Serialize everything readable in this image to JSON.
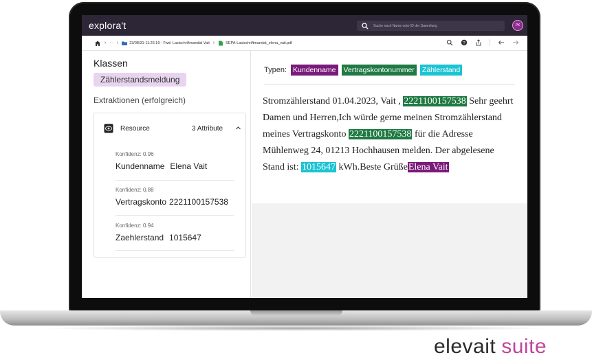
{
  "app": {
    "logo": "explora't",
    "search_placeholder": "Suche nach Name oder ID der Sammlung",
    "avatar_initials": "PK"
  },
  "breadcrumb": {
    "ellipsis": "···",
    "folder": "23/08/31-11:26:19 - Fwd: Lastschriftmandat Vait",
    "file": "SEPA-Lastschriftmandat_elena_vait.pdf"
  },
  "left": {
    "heading": "Klassen",
    "class_chip": "Zählerstandsmeldung",
    "extractions_label": "Extraktionen (erfolgreich)",
    "resource_label": "Resource",
    "attribute_count": "3 Attribute",
    "attributes": [
      {
        "confidence": "Konfidenz: 0.96",
        "key": "Kundenname",
        "value": "Elena Vait"
      },
      {
        "confidence": "Konfidenz: 0.88",
        "key": "Vertragskonto",
        "value": "2221100157538"
      },
      {
        "confidence": "Konfidenz: 0.94",
        "key": "Zaehlerstand",
        "value": "1015647"
      }
    ]
  },
  "document": {
    "types_label": "Typen:",
    "types": [
      {
        "label": "Kundenname",
        "color": "#7a1a7a"
      },
      {
        "label": "Vertragskontonummer",
        "color": "#1f7a43"
      },
      {
        "label": "Zählerstand",
        "color": "#1cc3d3"
      }
    ],
    "segments": [
      {
        "text": "Stromzählerstand 01.04.2023, Vait , "
      },
      {
        "text": "2221100157538",
        "highlight": "#1f7a43"
      },
      {
        "text": " Sehr geehrt Damen und Herren,Ich würde gerne meinen Stromzählerstand meines Vertragskonto "
      },
      {
        "text": "2221100157538",
        "highlight": "#1f7a43"
      },
      {
        "text": " für die Adresse Mühlenweg 24, 01213 Hochhausen melden. Der abgelesene Stand ist: "
      },
      {
        "text": "1015647",
        "highlight": "#1cc3d3"
      },
      {
        "text": " kWh.Beste Grüße"
      },
      {
        "text": "Elena Vait",
        "highlight": "#7a1a7a"
      }
    ]
  },
  "brand": {
    "part1": "elevait",
    "part2": "suite",
    "color_part2": "#c1449a"
  }
}
